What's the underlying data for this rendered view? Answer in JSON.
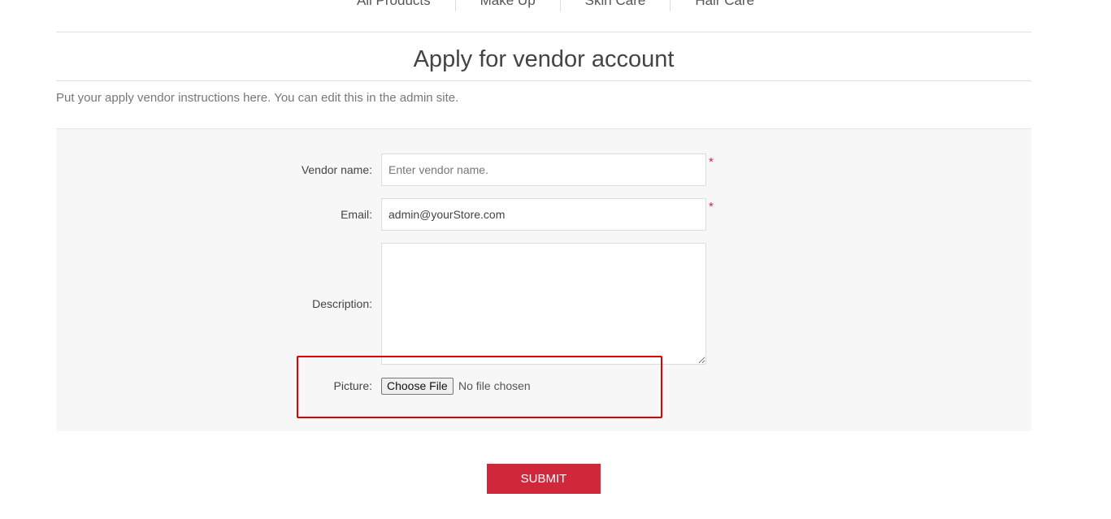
{
  "nav": {
    "items": [
      "All Products",
      "Make Up",
      "Skin Care",
      "Hair Care"
    ]
  },
  "page": {
    "title": "Apply for vendor account",
    "instructions": "Put your apply vendor instructions here. You can edit this in the admin site."
  },
  "form": {
    "vendor_name": {
      "label": "Vendor name:",
      "placeholder": "Enter vendor name.",
      "value": "",
      "required_mark": "*"
    },
    "email": {
      "label": "Email:",
      "placeholder": "",
      "value": "admin@yourStore.com",
      "required_mark": "*"
    },
    "description": {
      "label": "Description:",
      "value": ""
    },
    "picture": {
      "label": "Picture:",
      "button_label": "Choose File",
      "status": "No file chosen"
    },
    "submit_label": "SUBMIT"
  },
  "colors": {
    "accent": "#d0283a",
    "highlight": "#e00000",
    "panel_bg": "#f7f7f7"
  }
}
